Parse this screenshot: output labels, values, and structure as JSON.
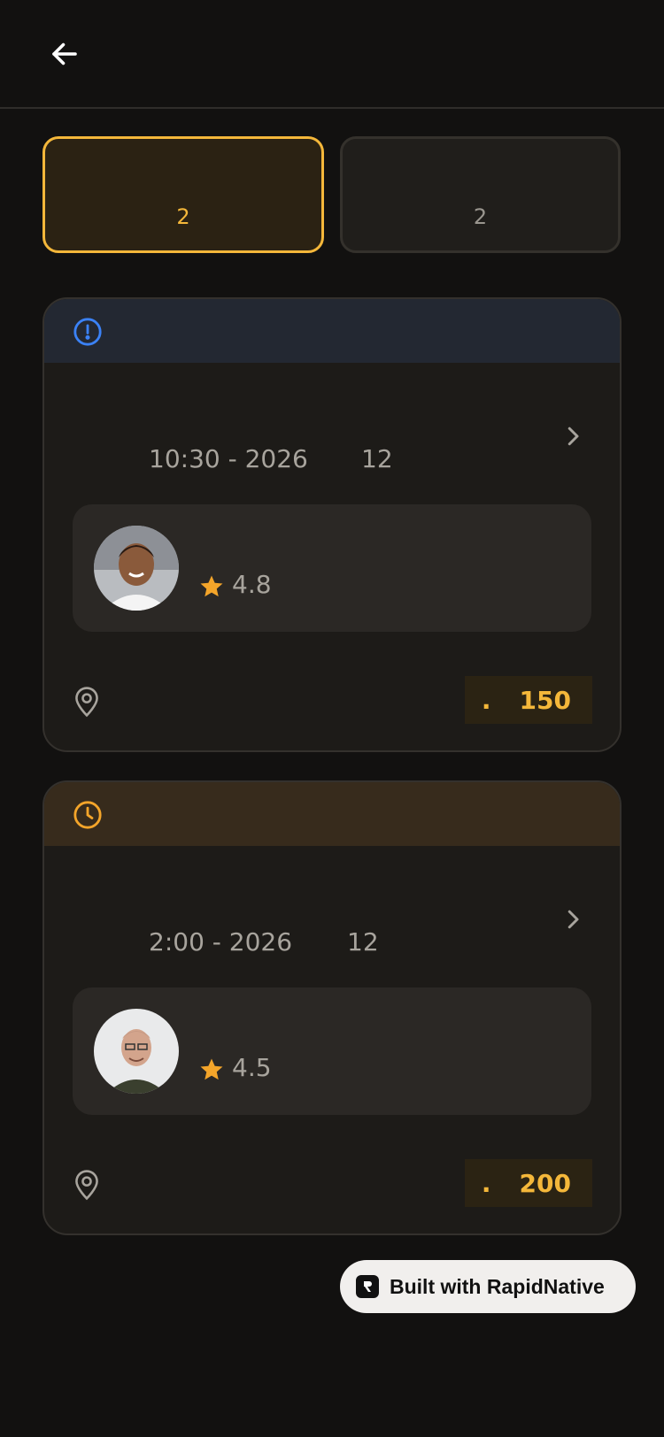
{
  "tabs": [
    {
      "count": "2",
      "active": true
    },
    {
      "count": "2",
      "active": false
    }
  ],
  "bookings": [
    {
      "status_icon": "alert-circle-icon",
      "status_color": "#3b82f6",
      "time": "10:30 - 2026",
      "day": "12",
      "rating": "4.8",
      "price_prefix": ".",
      "price": "150"
    },
    {
      "status_icon": "clock-icon",
      "status_color": "#f4a52a",
      "time": "2:00 - 2026",
      "day": "12",
      "rating": "4.5",
      "price_prefix": ".",
      "price": "200"
    }
  ],
  "badge": {
    "label": "Built with RapidNative"
  },
  "colors": {
    "accent": "#f4b73a",
    "background": "#121110",
    "card": "#1d1b18"
  }
}
